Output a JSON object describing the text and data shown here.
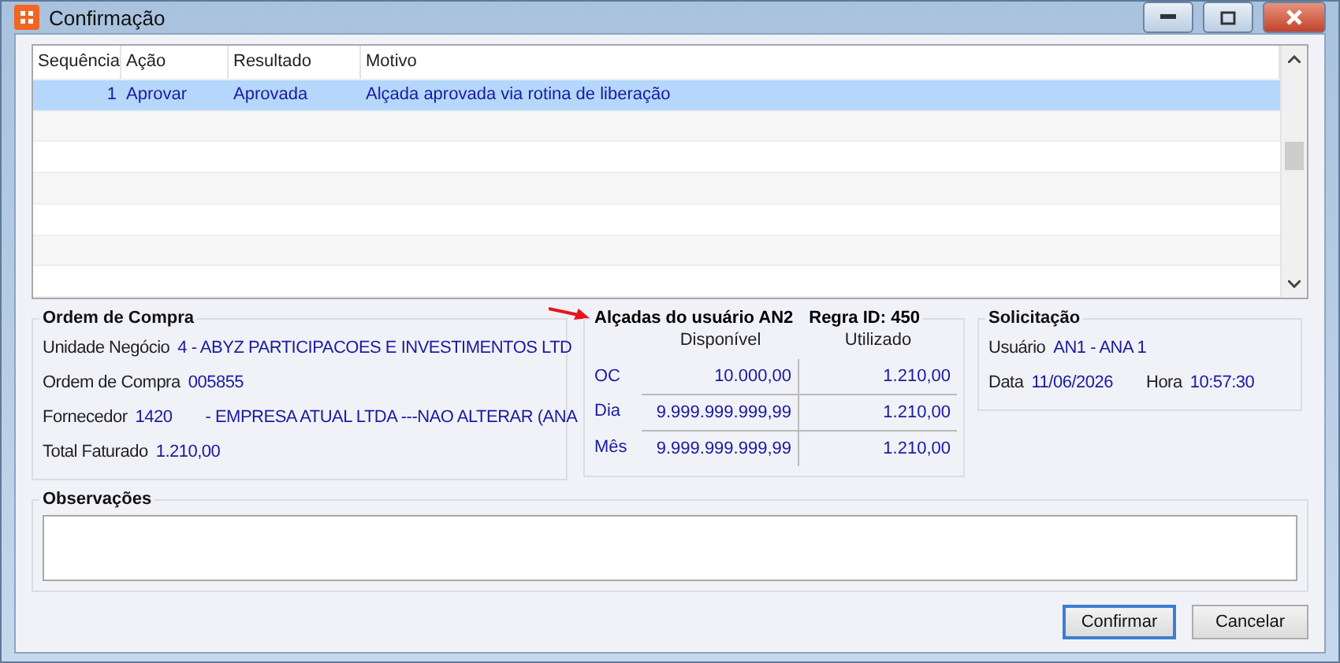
{
  "window": {
    "title": "Confirmação"
  },
  "table": {
    "columns": [
      "Sequência",
      "Ação",
      "Resultado",
      "Motivo"
    ],
    "rows": [
      {
        "cells": [
          "1",
          "Aprovar",
          "Aprovada",
          "Alçada aprovada via rotina de liberação"
        ],
        "selected": true
      }
    ]
  },
  "ordem_de_compra": {
    "title": "Ordem de Compra",
    "fields": [
      {
        "label": "Unidade Negócio",
        "values": [
          "4 - ABYZ PARTICIPACOES E INVESTIMENTOS LTD"
        ]
      },
      {
        "label": "Ordem de Compra",
        "values": [
          "005855"
        ]
      },
      {
        "label": "Fornecedor",
        "values": [
          "1420",
          "- EMPRESA ATUAL LTDA  ---NAO ALTERAR (ANA"
        ]
      },
      {
        "label": "Total Faturado",
        "values": [
          "1.210,00"
        ]
      }
    ]
  },
  "alcadas": {
    "title": "Alçadas do usuário AN2",
    "rule": "Regra ID: 450",
    "columns": [
      "Disponível",
      "Utilizado"
    ],
    "rows": [
      {
        "label": "OC",
        "available": "10.000,00",
        "used": "1.210,00"
      },
      {
        "label": "Dia",
        "available": "9.999.999.999,99",
        "used": "1.210,00"
      },
      {
        "label": "Mês",
        "available": "9.999.999.999,99",
        "used": "1.210,00"
      }
    ]
  },
  "solicitacao": {
    "title": "Solicitação",
    "user_label": "Usuário",
    "user": "AN1 - ANA 1",
    "date_label": "Data",
    "date": "11/06/2026",
    "time_label": "Hora",
    "time": "10:57:30"
  },
  "observacoes": {
    "title": "Observações"
  },
  "buttons": [
    {
      "label": "Confirmar",
      "default": true
    },
    {
      "label": "Cancelar",
      "default": false
    }
  ]
}
